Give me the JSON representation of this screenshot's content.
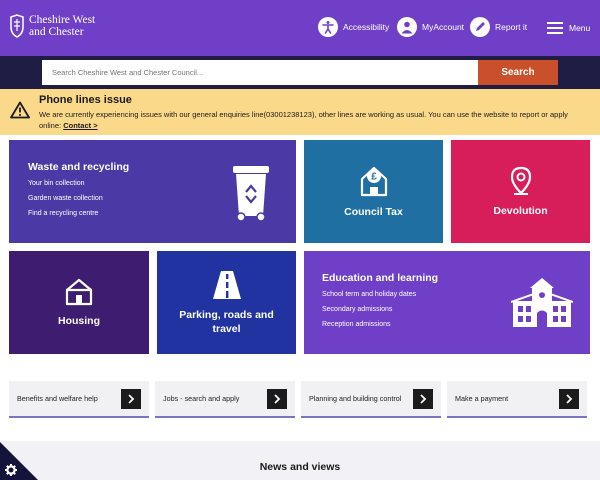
{
  "header": {
    "logo_line1": "Cheshire West",
    "logo_line2": "and Chester",
    "accessibility_label": "Accessibility",
    "myaccount_label": "MyAccount",
    "report_label": "Report it",
    "menu_label": "Menu",
    "background": "#6f3fc8"
  },
  "search": {
    "placeholder": "Search Cheshire West and Chester Council...",
    "button_label": "Search",
    "button_color": "#c9502b"
  },
  "alert": {
    "title": "Phone lines issue",
    "body": "We are currently experiencing issues with our general enquiries line(03001238123), other lines are working as usual. You can use the website to report or apply online:",
    "link_label": "Contact >",
    "background": "#fbd98a"
  },
  "tiles": {
    "waste": {
      "title": "Waste and recycling",
      "links": [
        "Your bin collection",
        "Garden waste collection",
        "Find a recycling centre"
      ],
      "icon": "wheelie-bin-icon"
    },
    "council_tax": {
      "title": "Council Tax",
      "icon": "house-pound-icon"
    },
    "devolution": {
      "title": "Devolution",
      "icon": "map-pin-icon"
    },
    "housing": {
      "title": "Housing",
      "icon": "house-icon"
    },
    "parking": {
      "title_line1": "Parking, roads and",
      "title_line2": "travel",
      "icon": "road-icon"
    },
    "education": {
      "title": "Education and learning",
      "links": [
        "School term and holiday dates",
        "Secondary admissions",
        "Reception admissions"
      ],
      "icon": "school-building-icon"
    }
  },
  "quick_links": [
    {
      "label": "Benefits and welfare help"
    },
    {
      "label": "Jobs - search and apply"
    },
    {
      "label": "Planning and building control"
    },
    {
      "label": "Make a payment"
    }
  ],
  "news": {
    "title": "News and views"
  }
}
